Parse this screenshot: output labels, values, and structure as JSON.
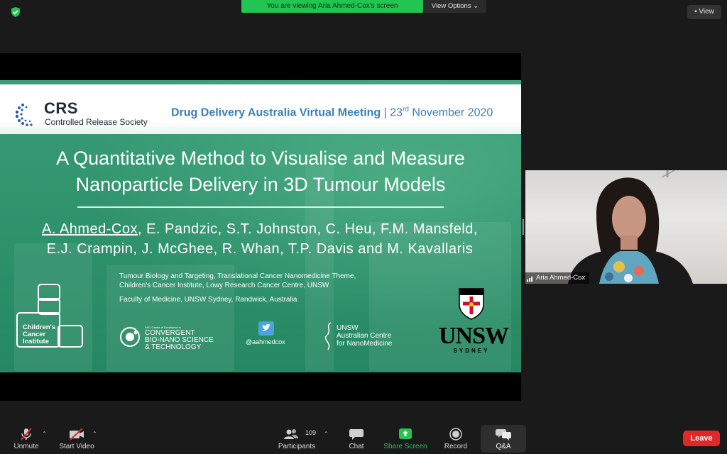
{
  "top_bar": {
    "banner_text": "You are viewing Aria Ahmed-Cox's screen",
    "view_options_label": "View Options",
    "view_button_label": "View"
  },
  "slide": {
    "org_abbr": "CRS",
    "org_name": "Controlled Release Society",
    "meeting_name": "Drug Delivery Australia Virtual Meeting",
    "meeting_separator": "|",
    "meeting_day": "23",
    "meeting_day_suffix": "rd",
    "meeting_month_year": "November 2020",
    "title_line1": "A Quantitative Method to Visualise and Measure",
    "title_line2": "Nanoparticle Delivery in 3D Tumour Models",
    "presenter": "A. Ahmed-Cox",
    "authors_line1_rest": ", E. Pandzic, S.T. Johnston, C. Heu, F.M. Mansfeld,",
    "authors_line2": "E.J. Crampin, J. McGhee, R. Whan, T.P. Davis and M. Kavallaris",
    "affiliation_line1": "Tumour Biology and Targeting, Translational Cancer Nanomedicine Theme,",
    "affiliation_line2": "Children's Cancer Institute, Lowy Research Cancer Centre, UNSW",
    "affiliation_line3": "Faculty of Medicine, UNSW Sydney, Randwick, Australia",
    "cci_line1": "Children's",
    "cci_line2": "Cancer",
    "cci_line3": "Institute",
    "cbns_small": "ARC Centre of Excellence in",
    "cbns_line1": "CONVERGENT",
    "cbns_line2": "BIO-NANO SCIENCE",
    "cbns_line3": "& TECHNOLOGY",
    "twitter_handle": "@aahmedcox",
    "acn_line1": "UNSW",
    "acn_line2": "Australian Centre",
    "acn_line3": "for NanoMedicine",
    "unsw_word": "UNSW",
    "unsw_sub": "SYDNEY"
  },
  "video_tile": {
    "participant_name": "Aria Ahmed-Cox"
  },
  "toolbar": {
    "unmute_label": "Unmute",
    "start_video_label": "Start Video",
    "participants_count": "109",
    "participants_label": "Participants",
    "chat_label": "Chat",
    "share_screen_label": "Share Screen",
    "record_label": "Record",
    "qa_label": "Q&A",
    "leave_label": "Leave"
  },
  "colors": {
    "banner_green": "#23c552",
    "share_green": "#23c552",
    "leave_red": "#e02828",
    "slide_green": "#2f936c",
    "meeting_blue": "#3b7fb6"
  }
}
